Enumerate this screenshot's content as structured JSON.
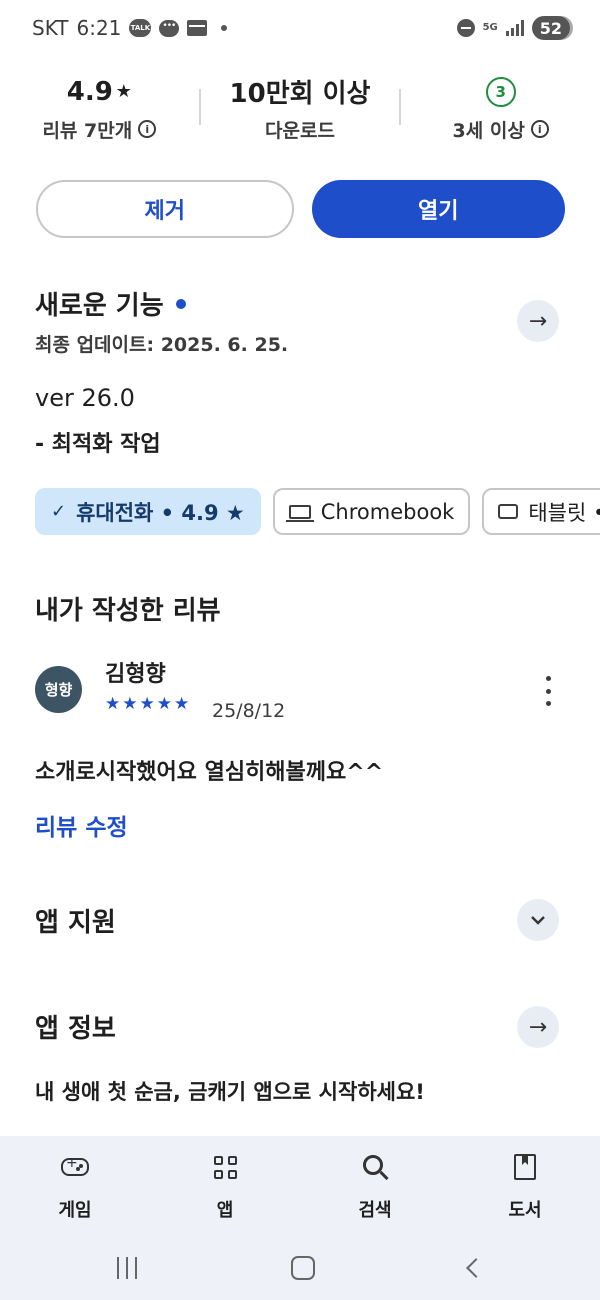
{
  "status_bar": {
    "carrier": "SKT",
    "time": "6:21",
    "talk_badge": "TALK",
    "network": "5G",
    "battery": "52"
  },
  "stats": {
    "rating": "4.9",
    "rating_star": "★",
    "reviews": "리뷰 7만개",
    "downloads": "10만회 이상",
    "downloads_label": "다운로드",
    "age_value": "3",
    "age_label": "3세 이상",
    "info_glyph": "i"
  },
  "actions": {
    "remove_label": "제거",
    "open_label": "열기"
  },
  "whats_new": {
    "title": "새로운 기능",
    "updated": "최종 업데이트: 2025. 6. 25.",
    "version": "ver 26.0",
    "notes": "- 최적화 작업",
    "arrow": "→"
  },
  "device_chips": [
    {
      "label": "휴대전화 • 4.9 ★",
      "check": "✓"
    },
    {
      "label": "Chromebook"
    },
    {
      "label": "태블릿 •"
    }
  ],
  "my_review": {
    "title": "내가 작성한 리뷰",
    "avatar_text": "형향",
    "author": "김형향",
    "stars": "★★★★★",
    "date": "25/8/12",
    "text": "소개로시작했어요 열심히해볼께요^^",
    "edit_label": "리뷰 수정"
  },
  "app_support": {
    "title": "앱 지원",
    "chevron": "⌄"
  },
  "app_info": {
    "title": "앱 정보",
    "arrow": "→",
    "description": "내 생애 첫 순금, 금캐기 앱으로 시작하세요!"
  },
  "bottom_nav": [
    {
      "label": "게임",
      "icon": "gamepad-icon"
    },
    {
      "label": "앱",
      "icon": "apps-icon"
    },
    {
      "label": "검색",
      "icon": "search-icon"
    },
    {
      "label": "도서",
      "icon": "book-icon"
    }
  ]
}
